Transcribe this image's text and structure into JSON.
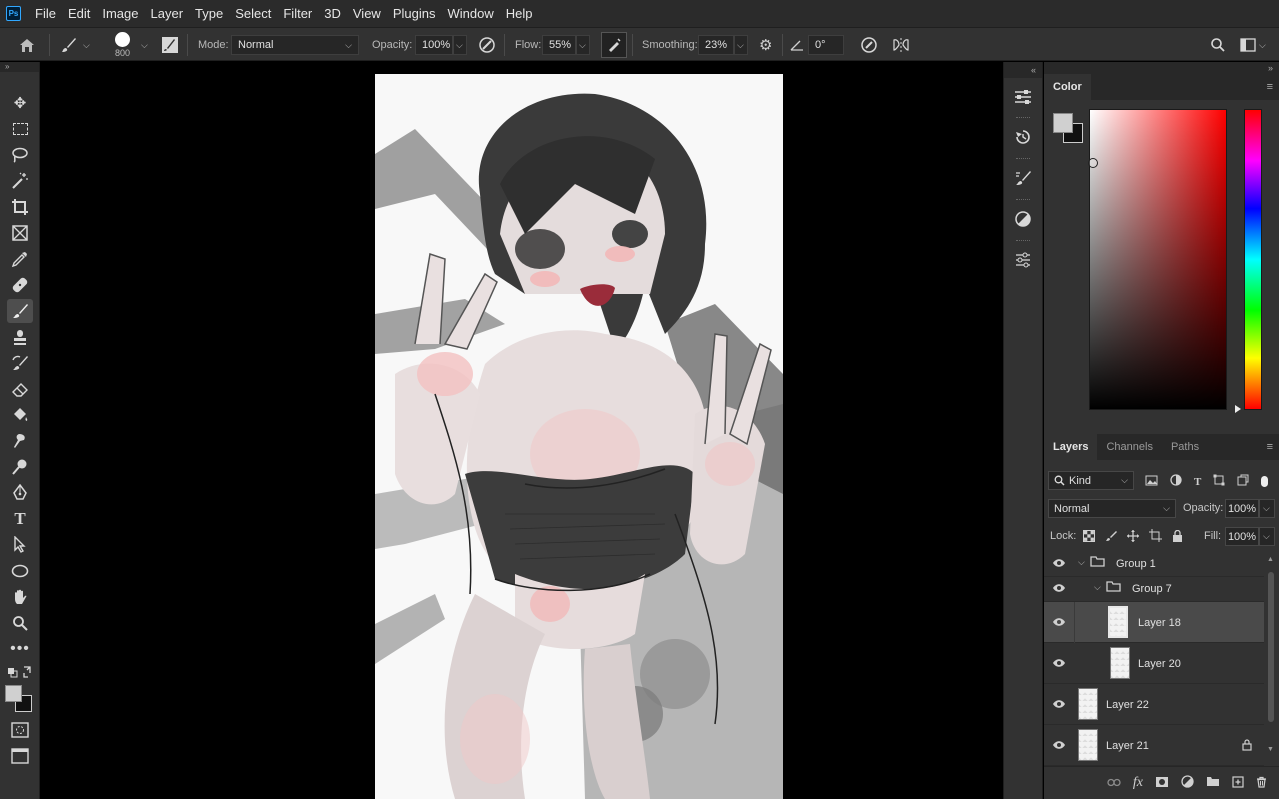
{
  "app": {
    "logo_text": "Ps"
  },
  "menu": [
    "File",
    "Edit",
    "Image",
    "Layer",
    "Type",
    "Select",
    "Filter",
    "3D",
    "View",
    "Plugins",
    "Window",
    "Help"
  ],
  "options": {
    "brush_size": "800",
    "mode_label": "Mode:",
    "mode_value": "Normal",
    "opacity_label": "Opacity:",
    "opacity_value": "100%",
    "flow_label": "Flow:",
    "flow_value": "55%",
    "smoothing_label": "Smoothing:",
    "smoothing_value": "23%",
    "angle_value": "0°"
  },
  "color_panel": {
    "tab": "Color",
    "foreground": "#d0d0d0",
    "background": "#111111"
  },
  "layers_panel": {
    "tabs": [
      "Layers",
      "Channels",
      "Paths"
    ],
    "filter_kind": "Kind",
    "blend_mode": "Normal",
    "opacity_label": "Opacity:",
    "opacity_value": "100%",
    "lock_label": "Lock:",
    "fill_label": "Fill:",
    "fill_value": "100%",
    "layers": [
      {
        "name": "Group 1"
      },
      {
        "name": "Group 7"
      },
      {
        "name": "Layer 18"
      },
      {
        "name": "Layer 20"
      },
      {
        "name": "Layer 22"
      },
      {
        "name": "Layer 21"
      }
    ]
  },
  "footer_icons": [
    "link-icon",
    "fx-icon",
    "mask-icon",
    "adjustment-icon",
    "folder-icon",
    "new-layer-icon",
    "trash-icon"
  ],
  "footer_fx": "fx"
}
